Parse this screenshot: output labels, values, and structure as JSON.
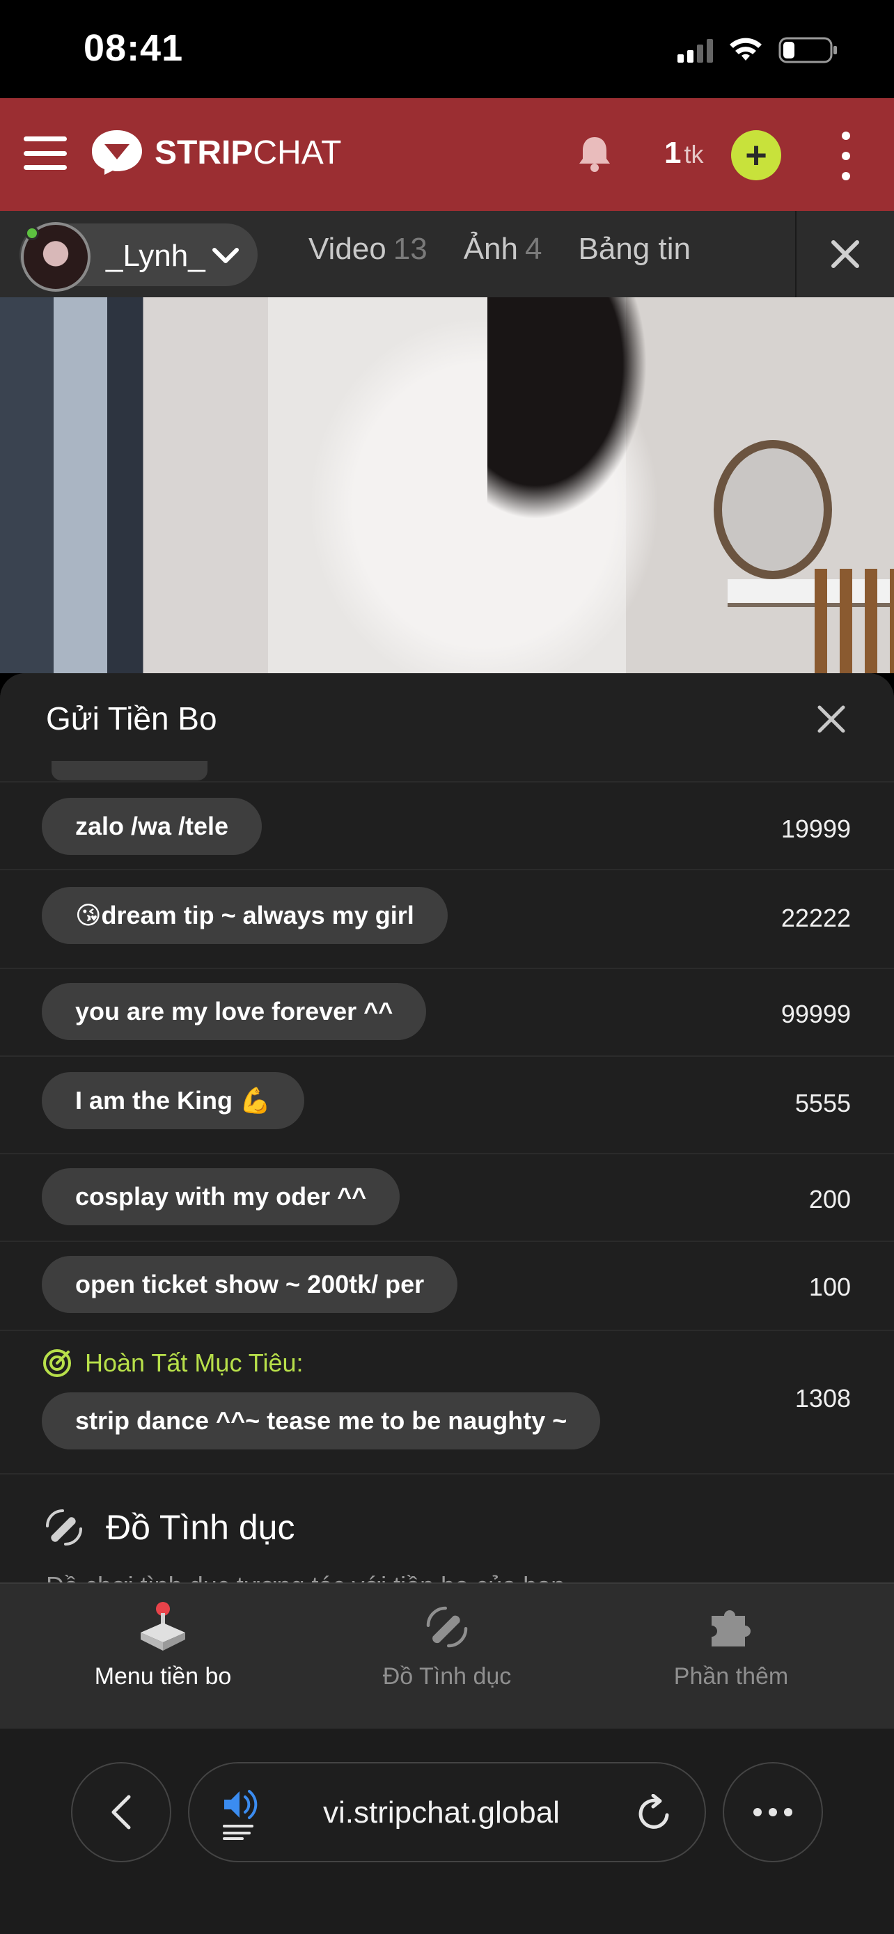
{
  "status_bar": {
    "time": "08:41"
  },
  "header": {
    "logo_bold": "STRIP",
    "logo_light": "CHAT",
    "token_count": "1",
    "token_unit": "tk",
    "add_label": "+"
  },
  "model_bar": {
    "name": "_Lynh_",
    "tabs": [
      {
        "label": "Video",
        "count": "13"
      },
      {
        "label": "Ảnh",
        "count": "4"
      },
      {
        "label": "Bảng tin",
        "count": ""
      }
    ]
  },
  "tip_panel": {
    "title": "Gửi Tiền Bo",
    "items": [
      {
        "label": "zalo /wa /tele",
        "price": "19999"
      },
      {
        "label": "😘dream tip ~ always my girl",
        "price": "22222"
      },
      {
        "label": "you are my love forever ^^",
        "price": "99999"
      },
      {
        "label": "I am the King 💪",
        "price": "5555"
      },
      {
        "label": "cosplay with my oder ^^",
        "price": "200"
      },
      {
        "label": "open ticket show ~ 200tk/ per",
        "price": "100"
      }
    ],
    "goal": {
      "label": "Hoàn Tất Mục Tiêu:",
      "item_label": "strip dance ^^~ tease me to be naughty ~",
      "price": "1308"
    },
    "section_title": "Đồ Tình dục",
    "section_subtitle": "Đồ chơi tình dục tương tác với tiền bo của bạn"
  },
  "bottom_tabs": [
    {
      "label": "Menu tiền bo",
      "icon": "joystick-icon",
      "active": true
    },
    {
      "label": "Đồ Tình dục",
      "icon": "toy-wave-icon",
      "active": false
    },
    {
      "label": "Phần thêm",
      "icon": "puzzle-icon",
      "active": false
    }
  ],
  "browser": {
    "url": "vi.stripchat.global"
  },
  "colors": {
    "header_bg": "#9b2e32",
    "accent_green": "#c8e23b",
    "goal_green": "#b8e04a",
    "panel_bg": "#1f1f1f",
    "pill_bg": "#3e3e3e"
  }
}
